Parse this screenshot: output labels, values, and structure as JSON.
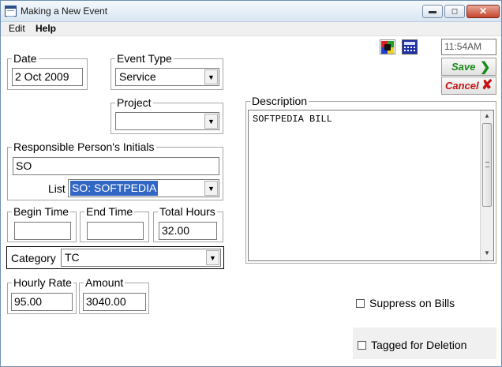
{
  "window": {
    "title": "Making a New Event"
  },
  "menu": [
    "Edit",
    "Help"
  ],
  "clock": "11:54AM",
  "buttons": {
    "save": "Save",
    "cancel": "Cancel"
  },
  "date": {
    "label": "Date",
    "value": "2 Oct 2009"
  },
  "event_type": {
    "label": "Event Type",
    "value": "Service"
  },
  "project": {
    "label": "Project",
    "value": ""
  },
  "responsible": {
    "label": "Responsible Person's Initials",
    "value": "SO",
    "list_label": "List",
    "list_value": "SO: SOFTPEDIA"
  },
  "times": {
    "begin_label": "Begin Time",
    "begin_value": "",
    "end_label": "End Time",
    "end_value": "",
    "total_label": "Total Hours",
    "total_value": "32.00"
  },
  "category": {
    "label": "Category",
    "value": "TC"
  },
  "hourly_rate": {
    "label": "Hourly Rate",
    "value": "95.00"
  },
  "amount": {
    "label": "Amount",
    "value": "3040.00"
  },
  "description": {
    "label": "Description",
    "value": "SOFTPEDIA BILL"
  },
  "suppress": {
    "label": "Suppress on Bills",
    "checked": false
  },
  "tagged": {
    "label": "Tagged for Deletion",
    "checked": false
  },
  "icons": {
    "app": "app-icon",
    "color_palette": "color-palette-icon",
    "calculator": "calculator-icon",
    "save": "check-arrow-icon",
    "cancel": "red-x-icon"
  },
  "colors": {
    "selection": "#3166c4",
    "save_green": "#1a8a1a",
    "cancel_red": "#c41414"
  }
}
